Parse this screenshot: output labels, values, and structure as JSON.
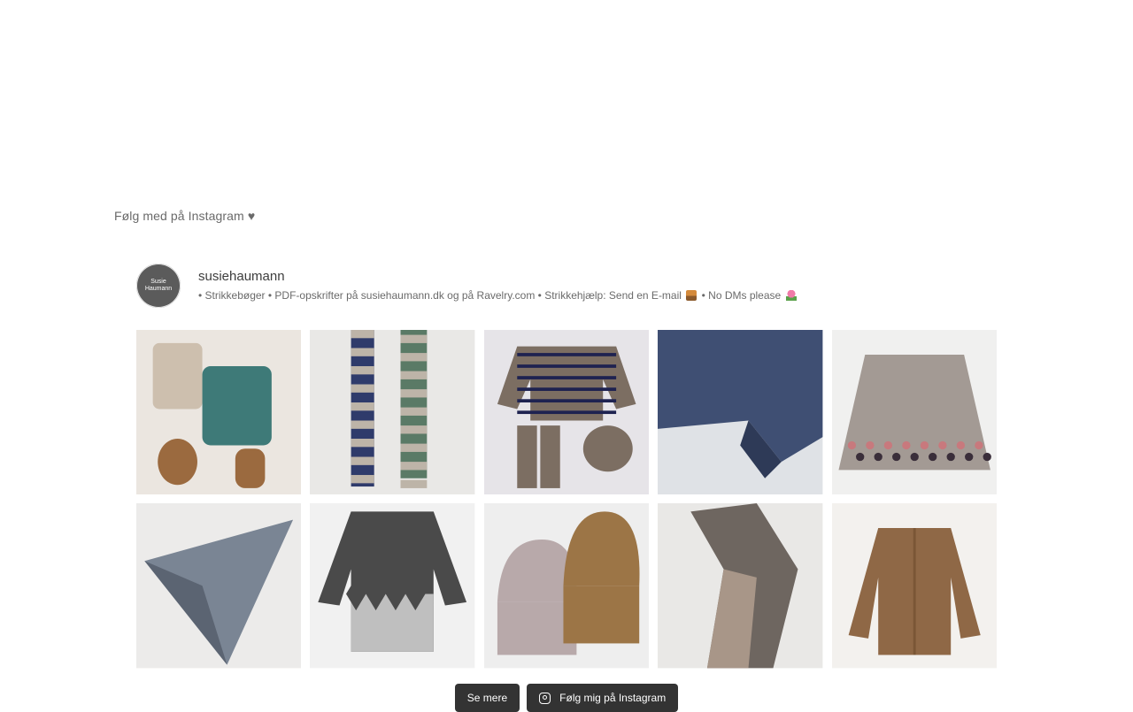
{
  "section_heading": "Følg med på Instagram ♥",
  "profile": {
    "username": "susiehaumann",
    "avatar_line1": "Susie",
    "avatar_line2": "Haumann",
    "bio_part1": "• Strikkebøger • PDF-opskrifter på susiehaumann.dk og på Ravelry.com • Strikkehjælp: Send en E-mail",
    "bio_part2": "• No DMs please"
  },
  "posts": [
    {
      "subject": "baby knit vest, shorts, mittens and socks",
      "colors": [
        "#ebe6e0",
        "#3e7a78",
        "#9b6a3f"
      ]
    },
    {
      "subject": "striped scarves hanging",
      "colors": [
        "#e9e8e6",
        "#2f3b6b",
        "#5a7a66"
      ]
    },
    {
      "subject": "striped baby sweater, trousers and hat",
      "colors": [
        "#e6e4e8",
        "#7c6e62",
        "#1e2250"
      ]
    },
    {
      "subject": "blue mohair sweater detail",
      "colors": [
        "#dfe2e6",
        "#3f4f73",
        "#2e3a57"
      ]
    },
    {
      "subject": "grey skirt with colorwork border",
      "colors": [
        "#f0f0ef",
        "#a39a94",
        "#c8797d"
      ]
    },
    {
      "subject": "grey triangular shawl",
      "colors": [
        "#ecebea",
        "#7a8594",
        "#5b6472"
      ]
    },
    {
      "subject": "argyle sweater",
      "colors": [
        "#f1f1f1",
        "#4a4a4a",
        "#bfbfbf"
      ]
    },
    {
      "subject": "two ribbed beanies",
      "colors": [
        "#eeeeee",
        "#b8a9aa",
        "#9c7546"
      ]
    },
    {
      "subject": "draped variegated wrap",
      "colors": [
        "#e9e8e6",
        "#6e6660",
        "#a89688"
      ]
    },
    {
      "subject": "brown textured cardigan",
      "colors": [
        "#f3f1ee",
        "#8f6846",
        "#7a5636"
      ]
    }
  ],
  "buttons": {
    "load_more": "Se mere",
    "follow": "Følg mig på Instagram"
  },
  "icons": {
    "follow": "instagram-icon"
  }
}
